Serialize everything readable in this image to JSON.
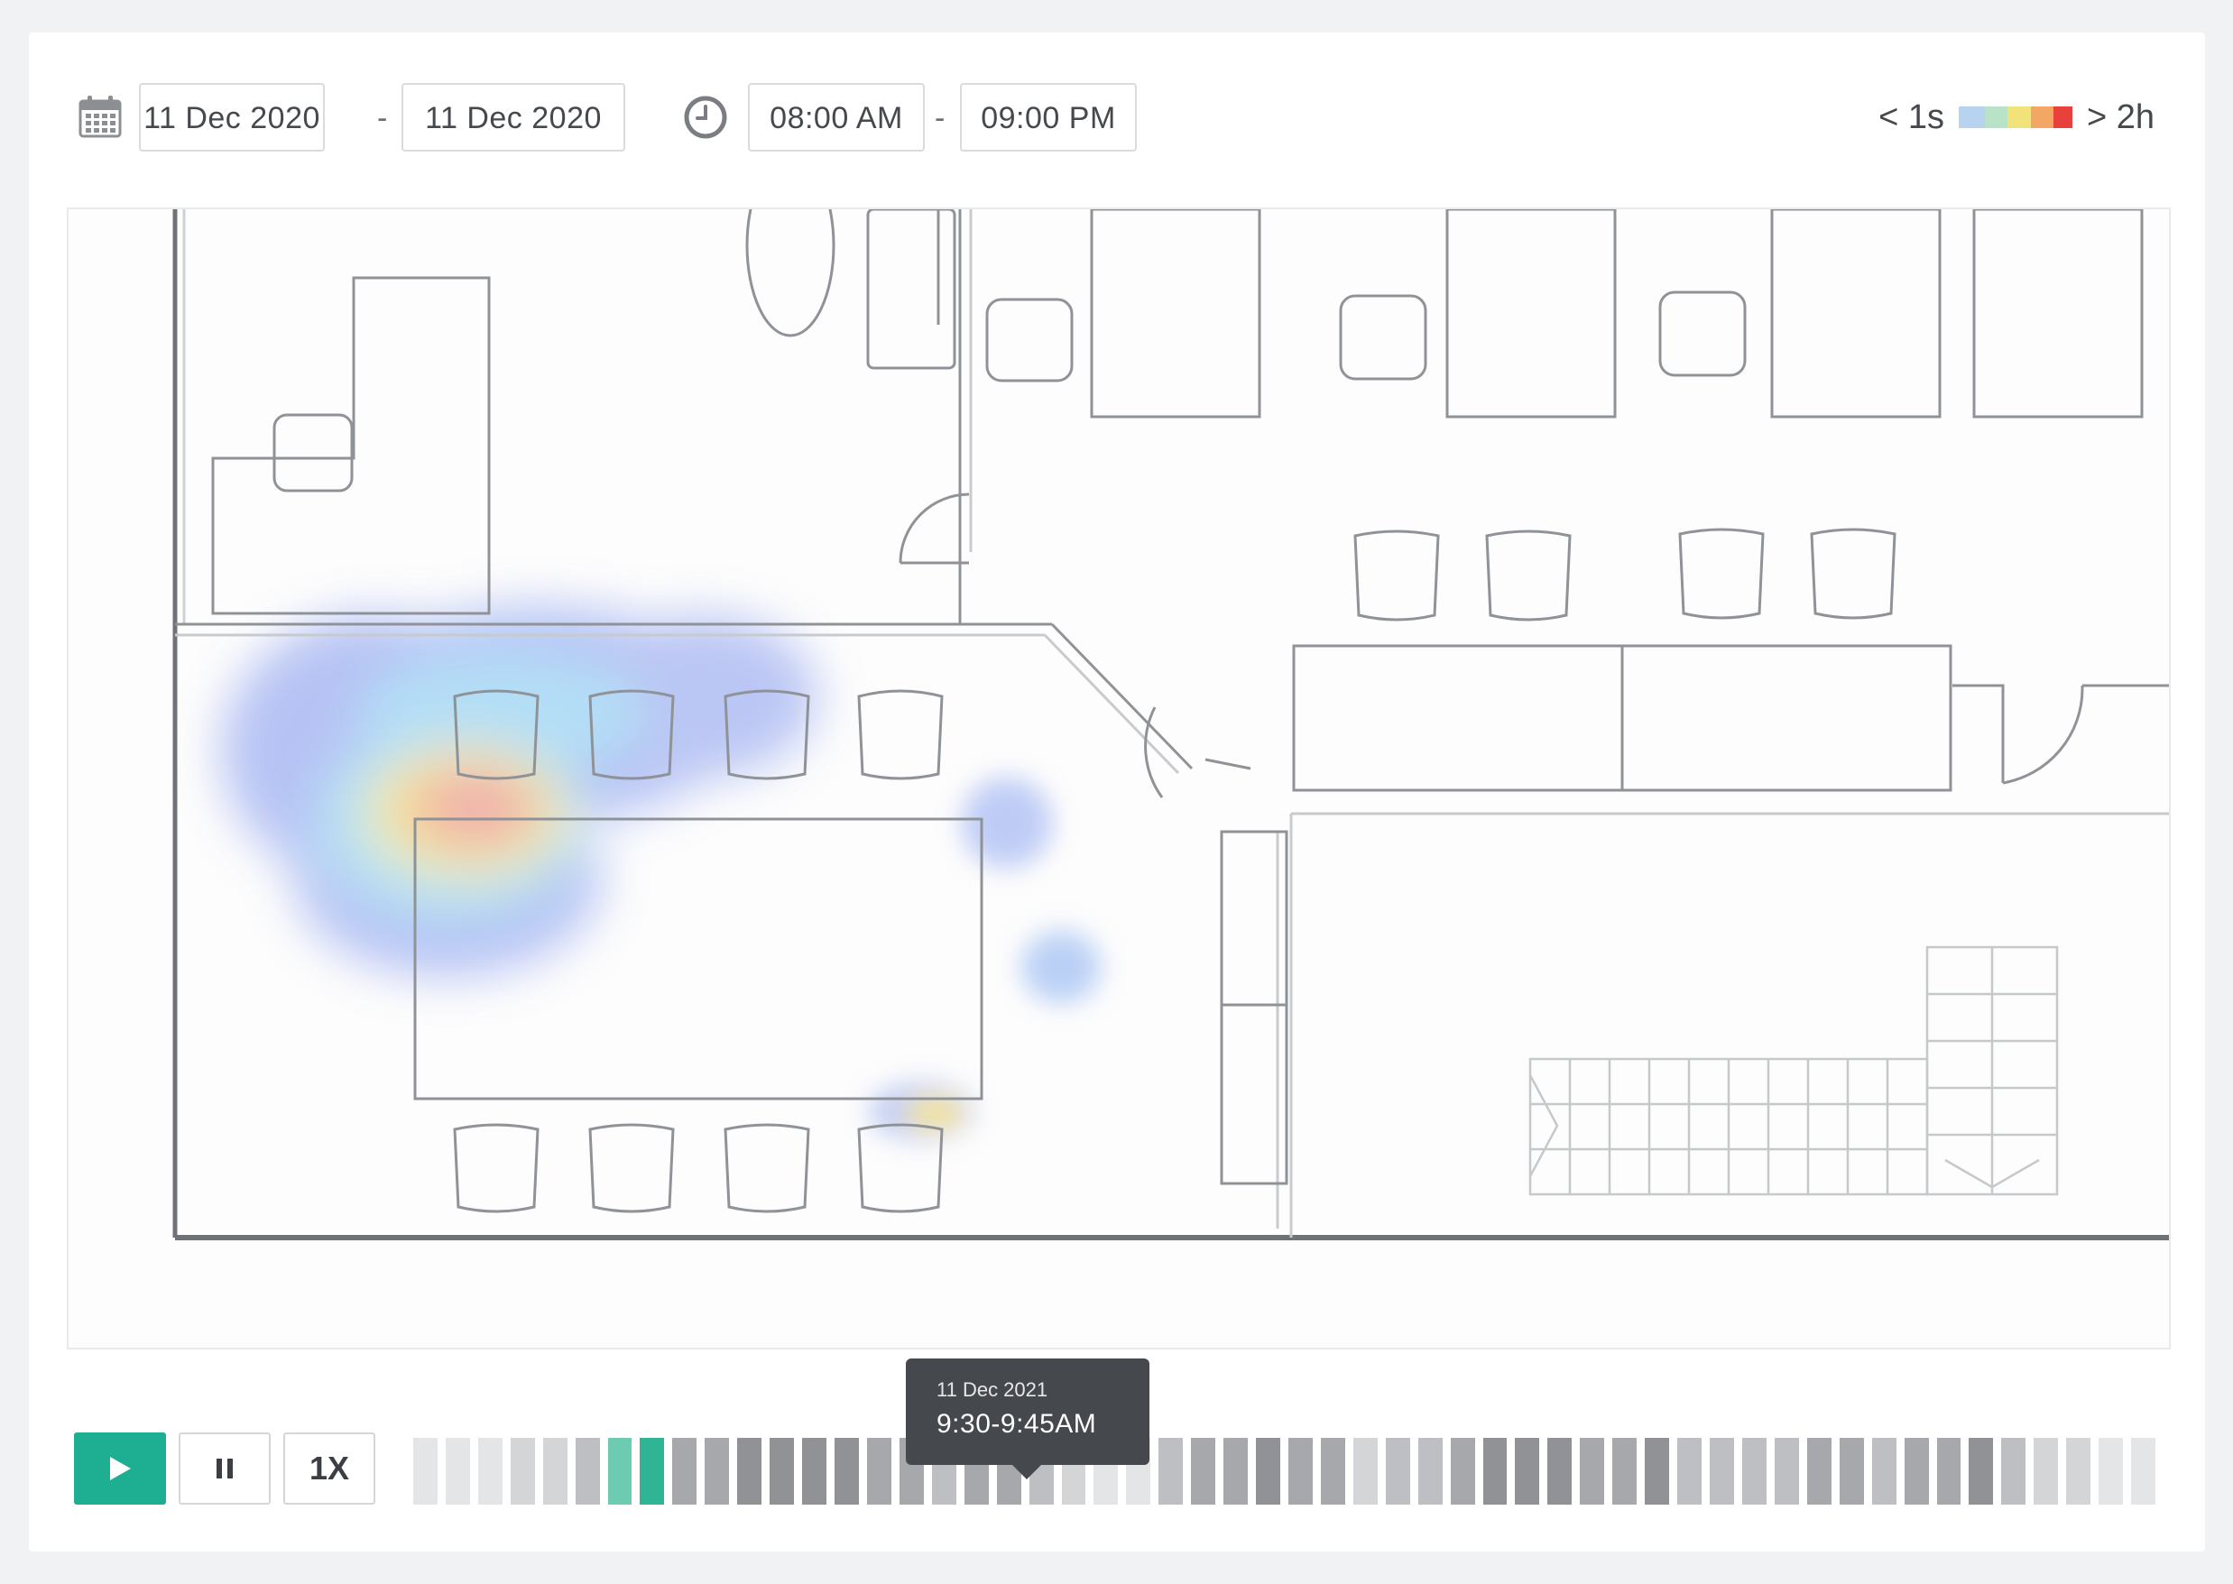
{
  "filters": {
    "start_date": "11 Dec 2020",
    "end_date": "11 Dec 2020",
    "date_separator": "-",
    "start_time": "08:00 AM",
    "end_time": "09:00 PM",
    "time_separator": "-"
  },
  "legend": {
    "min_label": "< 1s",
    "max_label": "> 2h",
    "colors": [
      "#b8d3f0",
      "#b9e3c6",
      "#f2e27a",
      "#f2a765",
      "#e8413c"
    ]
  },
  "playback": {
    "play_icon": "play-icon",
    "pause_icon": "pause-icon",
    "speed_label": "1X",
    "tooltip_date": "11 Dec 2021",
    "tooltip_time": "9:30-9:45AM",
    "active_slots": [
      6,
      7
    ],
    "slot_shades": [
      1,
      1,
      1,
      2,
      2,
      3,
      0,
      0,
      4,
      4,
      5,
      5,
      5,
      5,
      4,
      4,
      3,
      4,
      4,
      3,
      2,
      1,
      1,
      3,
      4,
      4,
      5,
      4,
      4,
      2,
      3,
      3,
      4,
      5,
      5,
      5,
      4,
      4,
      5,
      3,
      3,
      3,
      3,
      4,
      4,
      3,
      4,
      4,
      5,
      3,
      2,
      2,
      1,
      1
    ]
  }
}
